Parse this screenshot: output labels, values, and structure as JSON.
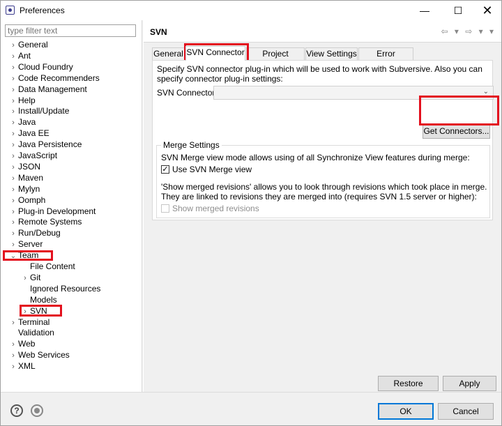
{
  "window": {
    "title": "Preferences",
    "minimize_glyph": "—",
    "maximize_glyph": "☐",
    "close_glyph": "✕"
  },
  "sidebar": {
    "filter_placeholder": "type filter text",
    "items": [
      {
        "label": "General",
        "expander": "›",
        "level": 0
      },
      {
        "label": "Ant",
        "expander": "›",
        "level": 0
      },
      {
        "label": "Cloud Foundry",
        "expander": "›",
        "level": 0
      },
      {
        "label": "Code Recommenders",
        "expander": "›",
        "level": 0
      },
      {
        "label": "Data Management",
        "expander": "›",
        "level": 0
      },
      {
        "label": "Help",
        "expander": "›",
        "level": 0
      },
      {
        "label": "Install/Update",
        "expander": "›",
        "level": 0
      },
      {
        "label": "Java",
        "expander": "›",
        "level": 0
      },
      {
        "label": "Java EE",
        "expander": "›",
        "level": 0
      },
      {
        "label": "Java Persistence",
        "expander": "›",
        "level": 0
      },
      {
        "label": "JavaScript",
        "expander": "›",
        "level": 0
      },
      {
        "label": "JSON",
        "expander": "›",
        "level": 0
      },
      {
        "label": "Maven",
        "expander": "›",
        "level": 0
      },
      {
        "label": "Mylyn",
        "expander": "›",
        "level": 0
      },
      {
        "label": "Oomph",
        "expander": "›",
        "level": 0
      },
      {
        "label": "Plug-in Development",
        "expander": "›",
        "level": 0
      },
      {
        "label": "Remote Systems",
        "expander": "›",
        "level": 0
      },
      {
        "label": "Run/Debug",
        "expander": "›",
        "level": 0
      },
      {
        "label": "Server",
        "expander": "›",
        "level": 0
      },
      {
        "label": "Team",
        "expander": "⌄",
        "level": 0
      },
      {
        "label": "File Content",
        "expander": "",
        "level": 1
      },
      {
        "label": "Git",
        "expander": "›",
        "level": 1
      },
      {
        "label": "Ignored Resources",
        "expander": "",
        "level": 1
      },
      {
        "label": "Models",
        "expander": "",
        "level": 1
      },
      {
        "label": "SVN",
        "expander": "›",
        "level": 1
      },
      {
        "label": "Terminal",
        "expander": "›",
        "level": 0
      },
      {
        "label": "Validation",
        "expander": "",
        "level": 0
      },
      {
        "label": "Web",
        "expander": "›",
        "level": 0
      },
      {
        "label": "Web Services",
        "expander": "›",
        "level": 0
      },
      {
        "label": "XML",
        "expander": "›",
        "level": 0
      }
    ]
  },
  "page": {
    "title": "SVN",
    "nav_back": "⇦ ▾",
    "nav_forward": "⇨ ▾",
    "menu": "▾"
  },
  "tabs": [
    {
      "label": "General"
    },
    {
      "label": "SVN Connector"
    },
    {
      "label": "Project structure"
    },
    {
      "label": "View Settings"
    },
    {
      "label": "Error Reporting"
    }
  ],
  "connector": {
    "description": "Specify SVN connector plug-in which will be used to work with Subversive. Also you can specify connector plug-in settings:",
    "label": "SVN Connector:",
    "value": "",
    "dropdown_glyph": "⌄",
    "get_button": "Get Connectors..."
  },
  "merge": {
    "legend": "Merge Settings",
    "text": "SVN Merge view mode allows using of all Synchronize View features during merge:",
    "use_merge_view_label": "Use SVN Merge view",
    "use_merge_view_checked": true,
    "revisions_text": "'Show merged revisions' allows you to look through revisions which took place in merge. They are linked to revisions they are merged into (requires SVN 1.5 server or higher):",
    "show_revisions_label": "Show merged revisions",
    "show_revisions_checked": false
  },
  "page_buttons": {
    "restore": "Restore Defaults",
    "apply": "Apply"
  },
  "dialog_buttons": {
    "help": "?",
    "ok": "OK",
    "cancel": "Cancel"
  },
  "colors": {
    "highlight": "#e3101e",
    "default_button_border": "#0078d7"
  }
}
